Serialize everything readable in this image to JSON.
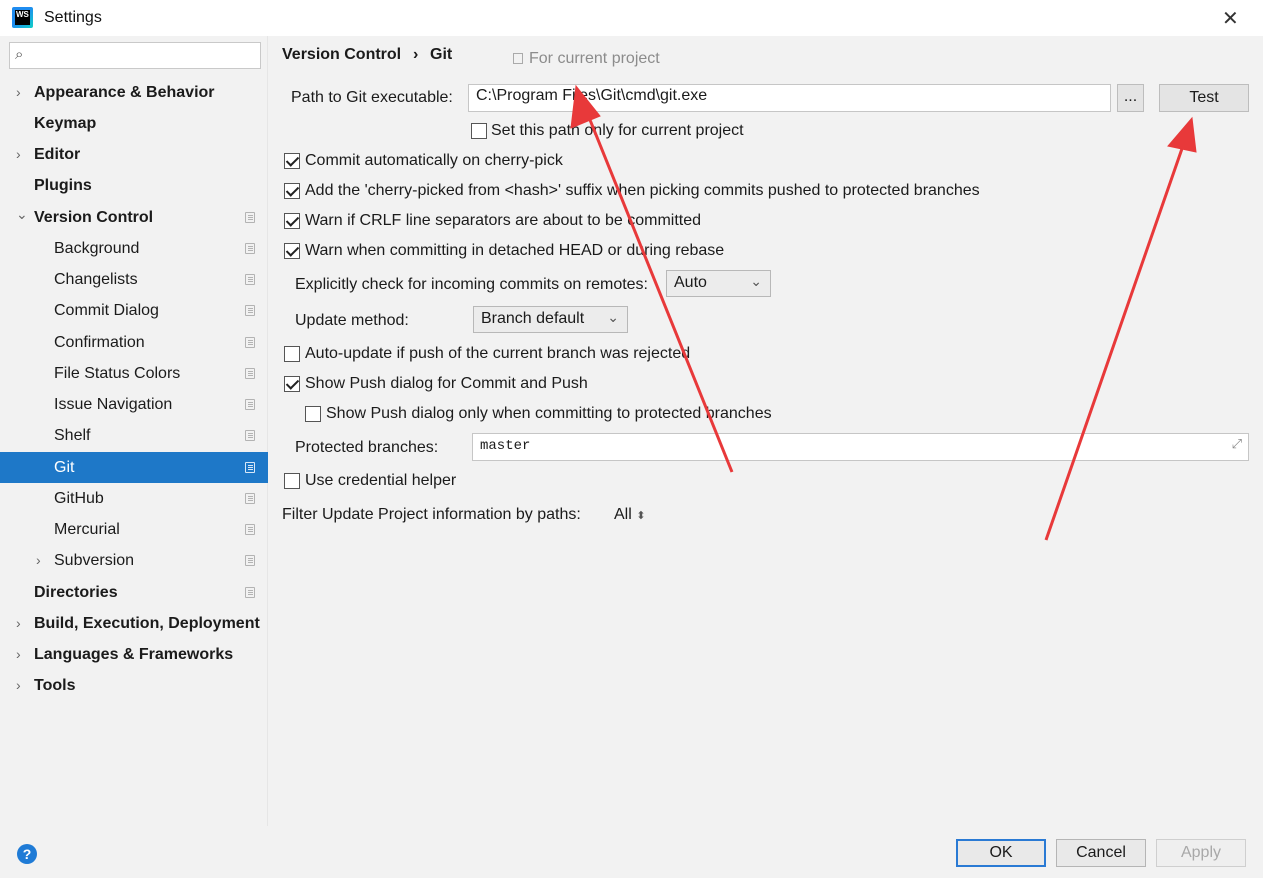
{
  "window": {
    "title": "Settings",
    "app_icon_text": "WS"
  },
  "sidebar": {
    "search": {
      "placeholder": ""
    },
    "items": [
      {
        "label": "Appearance & Behavior",
        "arrow": "›"
      },
      {
        "label": "Keymap"
      },
      {
        "label": "Editor",
        "arrow": "›"
      },
      {
        "label": "Plugins"
      },
      {
        "label": "Version Control",
        "arrow": "⌄"
      },
      {
        "label": "Background"
      },
      {
        "label": "Changelists"
      },
      {
        "label": "Commit Dialog"
      },
      {
        "label": "Confirmation"
      },
      {
        "label": "File Status Colors"
      },
      {
        "label": "Issue Navigation"
      },
      {
        "label": "Shelf"
      },
      {
        "label": "Git"
      },
      {
        "label": "GitHub"
      },
      {
        "label": "Mercurial"
      },
      {
        "label": "Subversion",
        "arrow": "›"
      },
      {
        "label": "Directories"
      },
      {
        "label": "Build, Execution, Deployment",
        "arrow": "›"
      },
      {
        "label": "Languages & Frameworks",
        "arrow": "›"
      },
      {
        "label": "Tools",
        "arrow": "›"
      }
    ]
  },
  "breadcrumb": {
    "parent": "Version Control",
    "separator": "›",
    "current": "Git",
    "scope": "For current project"
  },
  "git": {
    "path_label": "Path to Git executable:",
    "path_value": "C:\\Program Files\\Git\\cmd\\git.exe",
    "browse_label": "...",
    "test_label": "Test",
    "path_current_project_only": {
      "label": "Set this path only for current project",
      "checked": false
    },
    "commit_auto_cherry_pick": {
      "label": "Commit automatically on cherry-pick",
      "checked": true
    },
    "add_cherry_picked_suffix": {
      "label": "Add the 'cherry-picked from <hash>' suffix when picking commits pushed to protected branches",
      "checked": true
    },
    "warn_crlf": {
      "label": "Warn if CRLF line separators are about to be committed",
      "checked": true
    },
    "warn_detached_head": {
      "label": "Warn when committing in detached HEAD or during rebase",
      "checked": true
    },
    "incoming_label": "Explicitly check for incoming commits on remotes:",
    "incoming_value": "Auto",
    "update_method_label": "Update method:",
    "update_method_value": "Branch default",
    "auto_update_rejected": {
      "label": "Auto-update if push of the current branch was rejected",
      "checked": false
    },
    "show_push_dialog": {
      "label": "Show Push dialog for Commit and Push",
      "checked": true
    },
    "show_push_protected_only": {
      "label": "Show Push dialog only when committing to protected branches",
      "checked": false
    },
    "protected_label": "Protected branches:",
    "protected_value": "master",
    "use_credential_helper": {
      "label": "Use credential helper",
      "checked": false
    },
    "filter_label": "Filter Update Project information by paths:",
    "filter_value": "All"
  },
  "footer": {
    "help": "?",
    "ok": "OK",
    "cancel": "Cancel",
    "apply": "Apply"
  },
  "annotation_color": "#e8393a"
}
